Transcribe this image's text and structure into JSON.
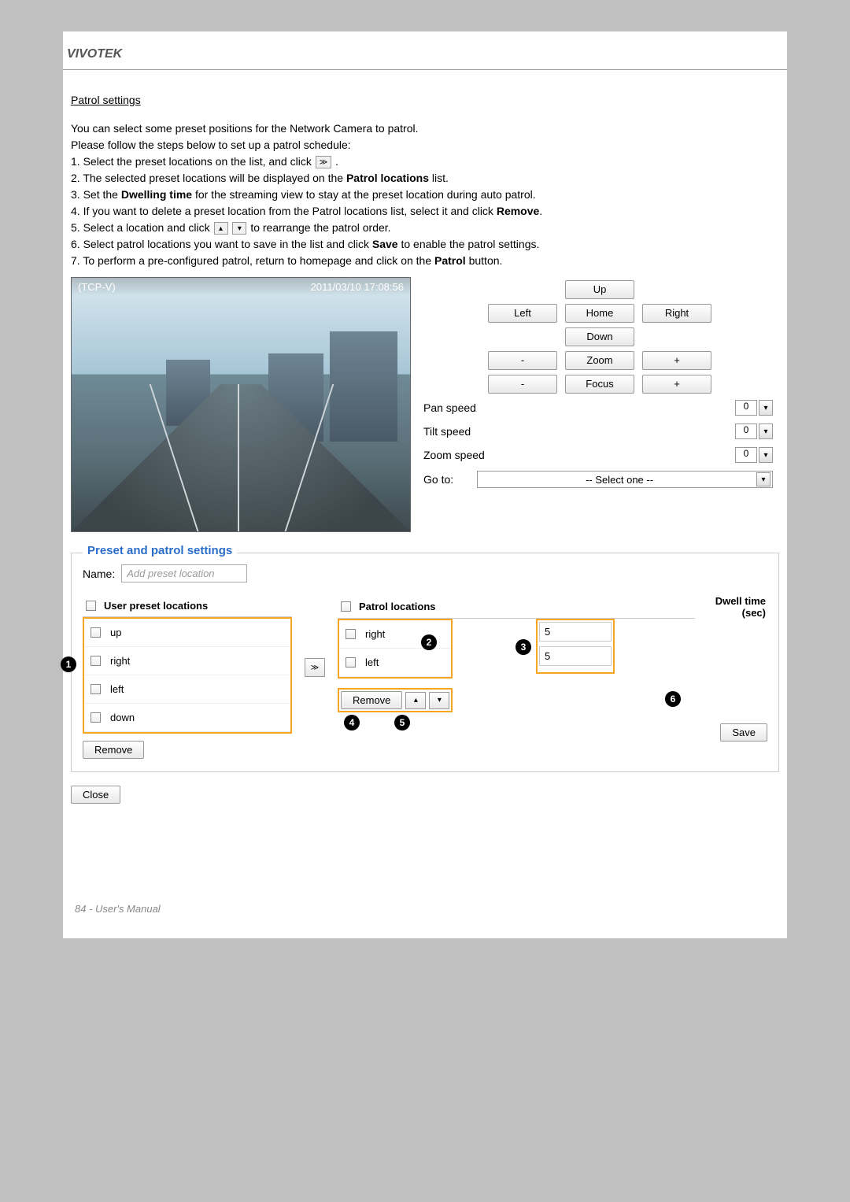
{
  "header": {
    "brand": "VIVOTEK"
  },
  "section": {
    "title": "Patrol settings"
  },
  "intro": {
    "l1": "You can select some preset positions for the Network Camera to patrol.",
    "l2": "Please follow the steps below to set up a patrol schedule:"
  },
  "steps": {
    "s1a": "1. Select the preset locations on the list, and click ",
    "s1b": ".",
    "s2a": "2. The selected preset locations will be displayed on the ",
    "s2b": "Patrol locations",
    "s2c": " list.",
    "s3a": "3. Set the ",
    "s3b": "Dwelling time",
    "s3c": " for the streaming view to stay at the preset location during auto patrol.",
    "s4a": "4. If you want to delete a preset location from the Patrol locations list, select it and click ",
    "s4b": "Remove",
    "s4c": ".",
    "s5a": "5. Select a location and click ",
    "s5b": " to rearrange the patrol order.",
    "s6a": "6. Select patrol locations you want to save in the list and click ",
    "s6b": "Save",
    "s6c": " to enable the patrol settings.",
    "s7a": "7. To perform a pre-configured patrol, return to homepage and click on the ",
    "s7b": "Patrol",
    "s7c": " button."
  },
  "video": {
    "title": "(TCP-V)",
    "timestamp": "2011/03/10  17:08:56"
  },
  "ctrl": {
    "up": "Up",
    "down": "Down",
    "left": "Left",
    "right": "Right",
    "home": "Home",
    "minus": "-",
    "plus": "+",
    "zoom": "Zoom",
    "focus": "Focus"
  },
  "speeds": {
    "pan_label": "Pan speed",
    "pan_val": "0",
    "tilt_label": "Tilt speed",
    "tilt_val": "0",
    "zoom_label": "Zoom speed",
    "zoom_val": "0",
    "goto_label": "Go to:",
    "goto_val": "-- Select one --"
  },
  "preset": {
    "legend": "Preset and patrol settings",
    "name_label": "Name:",
    "name_placeholder": "Add preset location",
    "user_header": "User preset locations",
    "patrol_header": "Patrol locations",
    "dwell_header": "Dwell time (sec)",
    "user_items": {
      "i0": "up",
      "i1": "right",
      "i2": "left",
      "i3": "down"
    },
    "patrol_items": {
      "i0": "right",
      "i1": "left"
    },
    "dwell_items": {
      "i0": "5",
      "i1": "5"
    },
    "remove": "Remove",
    "save": "Save",
    "close": "Close"
  },
  "callouts": {
    "c1": "1",
    "c2": "2",
    "c3": "3",
    "c4": "4",
    "c5": "5",
    "c6": "6"
  },
  "footer": "84 - User's Manual"
}
